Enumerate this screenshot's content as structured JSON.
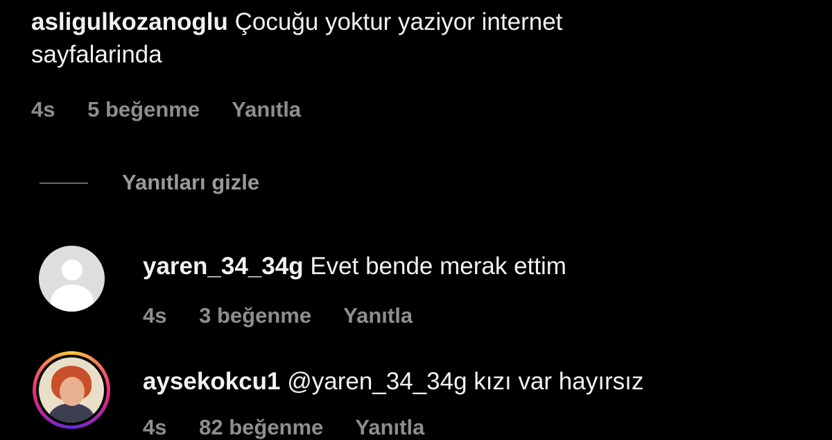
{
  "comments": [
    {
      "username": "asligulkozanoglu",
      "text_line1": "Çocuğu yoktur yaziyor internet",
      "text_line2": "sayfalarinda",
      "time": "4s",
      "likes": "5 beğenme",
      "reply": "Yanıtla"
    }
  ],
  "hide_replies": "Yanıtları gizle",
  "replies": [
    {
      "username": "yaren_34_34g",
      "text": "Evet bende merak ettim",
      "time": "4s",
      "likes": "3 beğenme",
      "reply": "Yanıtla",
      "avatar_icon": "default-user-icon"
    },
    {
      "username": "aysekokcu1",
      "text": "@yaren_34_34g kızı var hayırsız",
      "time": "4s",
      "likes": "82 beğenme",
      "reply": "Yanıtla",
      "avatar_icon": "profile-photo-story-ring"
    }
  ]
}
